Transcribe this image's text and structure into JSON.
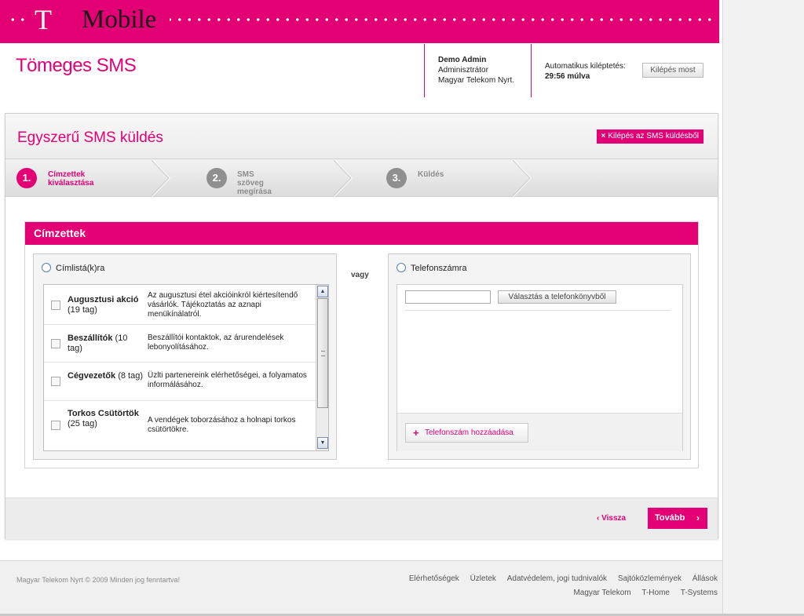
{
  "header": {
    "brand_t": "T",
    "brand_name": "Mobile",
    "app_title": "Tömeges SMS",
    "user_name": "Demo Admin",
    "user_role": "Adminisztrátor",
    "user_company": "Magyar Telekom Nyrt.",
    "auto_logout_label": "Automatikus kiléptetés:",
    "auto_logout_time": "29:56 múlva",
    "logout_now": "Kilépés most",
    "brand_color": "#e20074"
  },
  "panel": {
    "title": "Egyszerű SMS küldés",
    "exit_icon": "×",
    "exit_label": "Kilépés az SMS küldésből"
  },
  "steps": [
    {
      "num": "1.",
      "line1": "Címzettek",
      "line2": "kiválasztása",
      "state": "active"
    },
    {
      "num": "2.",
      "line1": "SMS szöveg",
      "line2": "megírása",
      "state": "inactive"
    },
    {
      "num": "3.",
      "line1": "Küldés",
      "line2": "",
      "state": "inactive"
    }
  ],
  "recipients": {
    "title": "Címzettek",
    "list_option": "Címlistá(k)ra",
    "or_label": "vagy",
    "phone_option": "Telefonszámra",
    "lists": [
      {
        "name": "Augusztusi akció",
        "count": " (19 tag)",
        "desc": "Az augusztusi étel akcióinkról kiértesítendő vásárlók. Tájékoztatás az aznapi menükínálatról."
      },
      {
        "name": "Beszállítók",
        "count": " (10 tag)",
        "desc": "Beszállítói kontaktok, az árurendelések lebonyolításához."
      },
      {
        "name": "Cégvezetők",
        "count": " (8 tag)",
        "desc": "Üzlti partenereink elérhetőségei, a folyamatos informálásához."
      },
      {
        "name": "Torkos Csütörtök",
        "count": " (25 tag)",
        "desc": "A vendégek toborzásához a holnapi torkos csütörtökre."
      }
    ],
    "phone_value": "",
    "phone_book_button": "Választás a telefonkönyvből",
    "add_icon": "+",
    "add_phone_button": "Telefonszám hozzáadása"
  },
  "nav": {
    "back_icon": "‹",
    "back_label": "Vissza",
    "next_label": "Tovább",
    "next_icon": "›"
  },
  "footer": {
    "copyright": "Magyar Telekom Nyrt © 2009 Minden jog fenntartva!",
    "links_row1": [
      "Elérhetőségek",
      "Üzletek",
      "Adatvédelem, jogi tudnivalók",
      "Sajtóközlemények",
      "Állások"
    ],
    "links_row2": [
      "Magyar Telekom",
      "T-Home",
      "T-Systems"
    ]
  }
}
